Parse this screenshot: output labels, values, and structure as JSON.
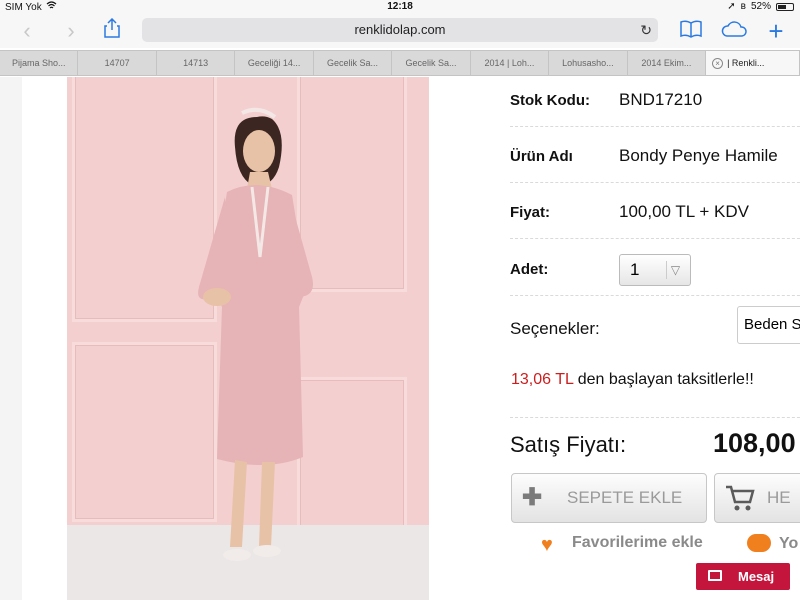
{
  "status_bar": {
    "carrier": "SIM Yok",
    "time": "12:18",
    "battery": "52%"
  },
  "browser": {
    "url": "renklidolap.com",
    "tabs": [
      {
        "label": "Pijama Sho..."
      },
      {
        "label": "14707"
      },
      {
        "label": "14713"
      },
      {
        "label": "Geceliği 14..."
      },
      {
        "label": "Gecelik Sa..."
      },
      {
        "label": "Gecelik Sa..."
      },
      {
        "label": "2014 | Loh..."
      },
      {
        "label": "Lohusasho..."
      },
      {
        "label": "2014 Ekim..."
      },
      {
        "label": "| Renkli..."
      }
    ]
  },
  "product": {
    "fields": [
      {
        "label": "Stok Kodu:",
        "value": "BND17210"
      },
      {
        "label": "Ürün Adı",
        "value": "Bondy Penye Hamile"
      },
      {
        "label": "Fiyat:",
        "value": "100,00 TL + KDV"
      }
    ],
    "quantity_label": "Adet:",
    "quantity_value": "1",
    "options_label": "Seçenekler:",
    "options_value": "Beden S",
    "installment_amount": "13,06 TL",
    "installment_text": " den başlayan taksitlerle!!",
    "sale_price_label": "Satış Fiyatı:",
    "sale_price": "108,00",
    "add_to_cart": "SEPETE EKLE",
    "buy_now": "HE",
    "favorites": "Favorilerime ekle",
    "other_action": "Yo",
    "message": "Mesaj"
  },
  "colors": {
    "accent_red": "#cc1e1e",
    "orange": "#f07f1e",
    "message_button": "#c4163d",
    "ios_blue": "#2a7ae2"
  },
  "icons": [
    "wifi-icon",
    "location-icon",
    "bluetooth-icon",
    "battery-icon",
    "back-icon",
    "forward-icon",
    "share-icon",
    "bookmarks-icon",
    "icloud-icon",
    "new-tab-icon",
    "reload-icon",
    "close-tab-icon",
    "plus-icon",
    "cart-icon",
    "heart-icon",
    "chat-bubble-icon",
    "mail-icon"
  ]
}
